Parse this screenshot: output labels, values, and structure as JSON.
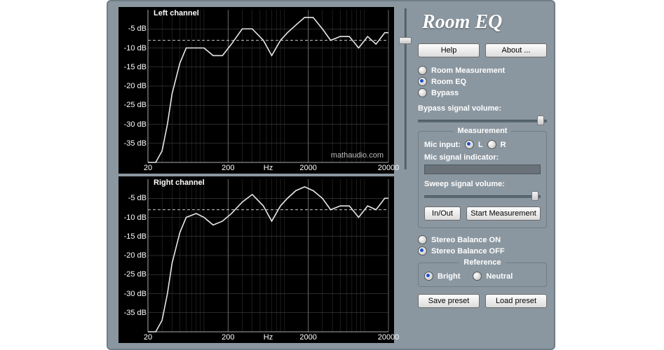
{
  "app_title": "Room EQ",
  "watermark": "mathaudio.com",
  "buttons": {
    "help": "Help",
    "about": "About ...",
    "in_out": "In/Out",
    "start_meas": "Start Measurement",
    "save_preset": "Save preset",
    "load_preset": "Load preset"
  },
  "mode": {
    "measurement": "Room Measurement",
    "eq": "Room EQ",
    "bypass": "Bypass",
    "selected": "eq"
  },
  "labels": {
    "bypass_vol": "Bypass signal volume:",
    "measurement_legend": "Measurement",
    "mic_input": "Mic input:",
    "mic_L": "L",
    "mic_R": "R",
    "mic_indicator": "Mic signal indicator:",
    "sweep_vol": "Sweep signal volume:",
    "stereo_on": "Stereo Balance ON",
    "stereo_off": "Stereo Balance OFF",
    "reference_legend": "Reference",
    "bright": "Bright",
    "neutral": "Neutral"
  },
  "mic_selected": "L",
  "stereo_balance": "off",
  "reference": "bright",
  "sliders": {
    "vertical_pct": 18,
    "bypass_vol_pct": 95,
    "sweep_vol_pct": 95
  },
  "plots": {
    "left_title": "Left channel",
    "right_title": "Right channel",
    "ylabels": [
      "-5 dB",
      "-10 dB",
      "-15 dB",
      "-20 dB",
      "-25 dB",
      "-30 dB",
      "-35 dB"
    ],
    "xlabels": [
      "20",
      "200",
      "Hz",
      "2000",
      "20000"
    ]
  },
  "chart_data": [
    {
      "type": "line",
      "title": "Left channel",
      "xlabel": "Hz",
      "ylabel": "dB",
      "xscale": "log",
      "xlim": [
        20,
        20000
      ],
      "ylim": [
        -40,
        0
      ],
      "reference_line_db": -8,
      "series": [
        {
          "name": "response",
          "x": [
            20,
            25,
            30,
            35,
            40,
            50,
            60,
            80,
            100,
            130,
            170,
            220,
            300,
            400,
            550,
            700,
            900,
            1100,
            1400,
            1800,
            2300,
            3000,
            3800,
            5000,
            6500,
            8500,
            11000,
            14000,
            18000,
            20000
          ],
          "y": [
            -40,
            -40,
            -37,
            -30,
            -22,
            -14,
            -10,
            -10,
            -10,
            -12,
            -12,
            -9,
            -5,
            -5,
            -8,
            -12,
            -8,
            -6,
            -4,
            -2,
            -2,
            -5,
            -8,
            -7,
            -7,
            -10,
            -7,
            -9,
            -6,
            -6
          ]
        }
      ]
    },
    {
      "type": "line",
      "title": "Right channel",
      "xlabel": "Hz",
      "ylabel": "dB",
      "xscale": "log",
      "xlim": [
        20,
        20000
      ],
      "ylim": [
        -40,
        0
      ],
      "reference_line_db": -8,
      "series": [
        {
          "name": "response",
          "x": [
            20,
            25,
            30,
            35,
            40,
            50,
            60,
            80,
            100,
            130,
            170,
            220,
            300,
            400,
            550,
            700,
            900,
            1100,
            1400,
            1800,
            2300,
            3000,
            3800,
            5000,
            6500,
            8500,
            11000,
            14000,
            18000,
            20000
          ],
          "y": [
            -40,
            -40,
            -37,
            -30,
            -22,
            -14,
            -10,
            -9,
            -10,
            -12,
            -11,
            -9,
            -6,
            -4,
            -7,
            -11,
            -7,
            -5,
            -3,
            -2,
            -3,
            -5,
            -8,
            -7,
            -7,
            -10,
            -7,
            -8,
            -5,
            -5
          ]
        }
      ]
    }
  ]
}
